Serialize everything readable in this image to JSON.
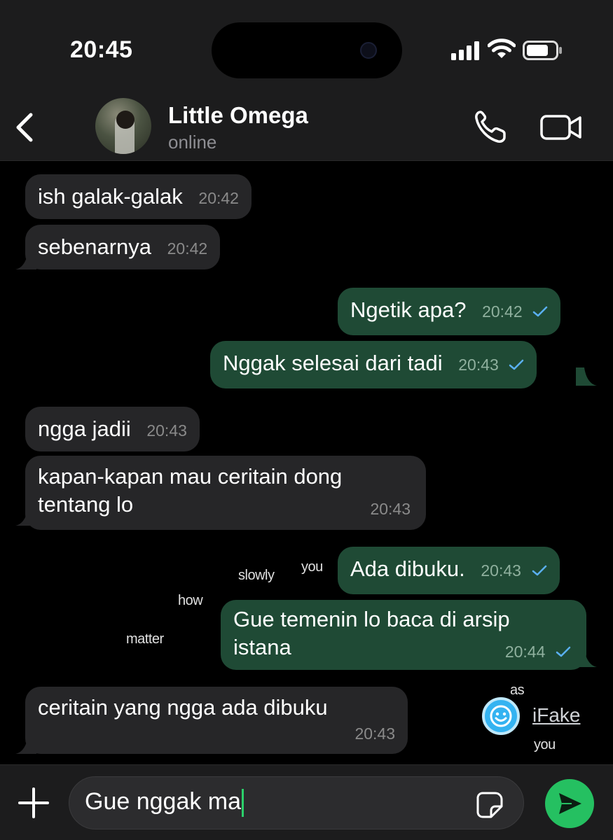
{
  "status_bar": {
    "time": "20:45"
  },
  "header": {
    "contact_name": "Little Omega",
    "contact_status": "online"
  },
  "messages": [
    {
      "dir": "in",
      "text": "ish galak-galak",
      "time": "20:42"
    },
    {
      "dir": "in",
      "text": "sebenarnya",
      "time": "20:42"
    },
    {
      "dir": "out",
      "text": "Ngetik apa?",
      "time": "20:42",
      "read": true
    },
    {
      "dir": "out",
      "text": "Nggak selesai dari tadi",
      "time": "20:43",
      "read": true
    },
    {
      "dir": "in",
      "text": "ngga jadii",
      "time": "20:43"
    },
    {
      "dir": "in",
      "text": "kapan-kapan mau ceritain dong",
      "text2": "tentang lo",
      "time": "20:43"
    },
    {
      "dir": "out",
      "text": "Ada dibuku.",
      "time": "20:43",
      "read": true
    },
    {
      "dir": "out",
      "text": "Gue temenin lo baca di arsip",
      "text2": "istana",
      "time": "20:44",
      "read": true
    },
    {
      "dir": "in",
      "text": "ceritain yang ngga ada dibuku",
      "time": "20:43"
    }
  ],
  "overlay_words": [
    "slowly",
    "you",
    "how",
    "matter",
    "as",
    "you"
  ],
  "watermark": {
    "label": "iFake"
  },
  "composer": {
    "draft_text": "Gue nggak ma"
  },
  "colors": {
    "outgoing_bubble": "#1f4a35",
    "incoming_bubble": "#262628",
    "send_button": "#25c061",
    "read_check": "#5ab0f5"
  }
}
